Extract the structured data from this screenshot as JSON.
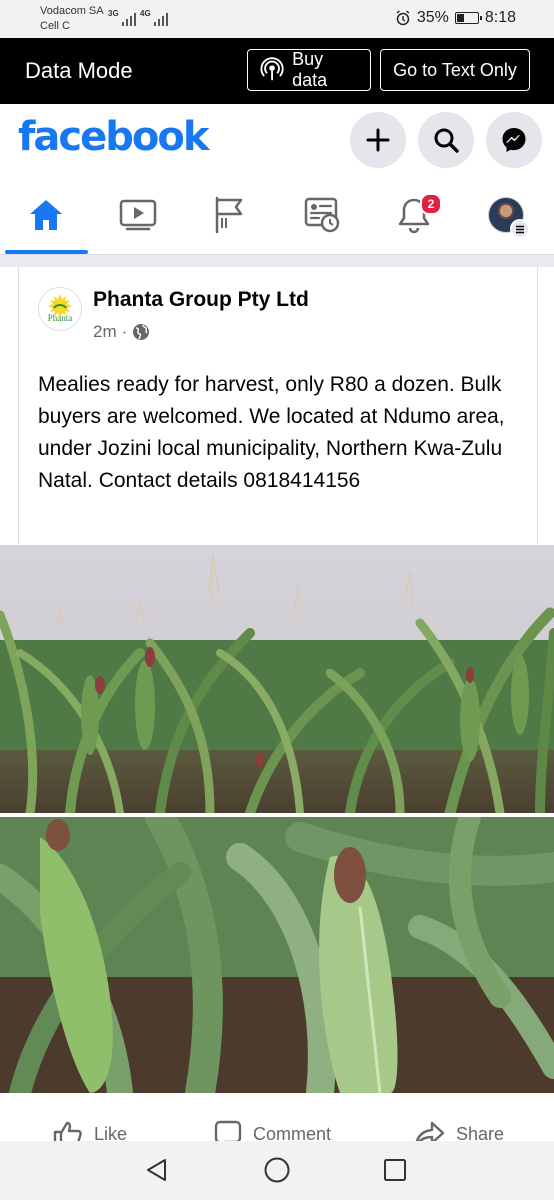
{
  "status_bar": {
    "carrier": "Vodacom SA",
    "cell": "Cell C",
    "net1": "3G",
    "net2": "4G",
    "battery_percent": "35%",
    "battery_level": 0.35,
    "time": "8:18"
  },
  "data_mode": {
    "title": "Data Mode",
    "buy_data_label": "Buy data",
    "text_only_label": "Go to Text Only"
  },
  "header": {
    "logo_text": "facebook",
    "brand_color": "#1877f2"
  },
  "nav_tabs": [
    {
      "name": "home",
      "icon": "home-icon",
      "active": true
    },
    {
      "name": "watch",
      "icon": "video-icon"
    },
    {
      "name": "pages",
      "icon": "flag-icon"
    },
    {
      "name": "news",
      "icon": "news-feed-clock-icon"
    },
    {
      "name": "notifications",
      "icon": "bell-icon",
      "badge": "2"
    },
    {
      "name": "menu",
      "icon": "profile-menu-icon"
    }
  ],
  "post": {
    "page_name": "Phanta Group Pty Ltd",
    "logo_text": "Phanta",
    "time": "2m",
    "separator": "·",
    "audience_icon": "globe-icon",
    "text": "Mealies ready for harvest, only R80 a dozen. Bulk buyers are welcomed. We located at Ndumo area, under Jozini local municipality, Northern Kwa-Zulu Natal. Contact details 0818414156"
  },
  "actions": {
    "like": "Like",
    "comment": "Comment",
    "share": "Share"
  }
}
